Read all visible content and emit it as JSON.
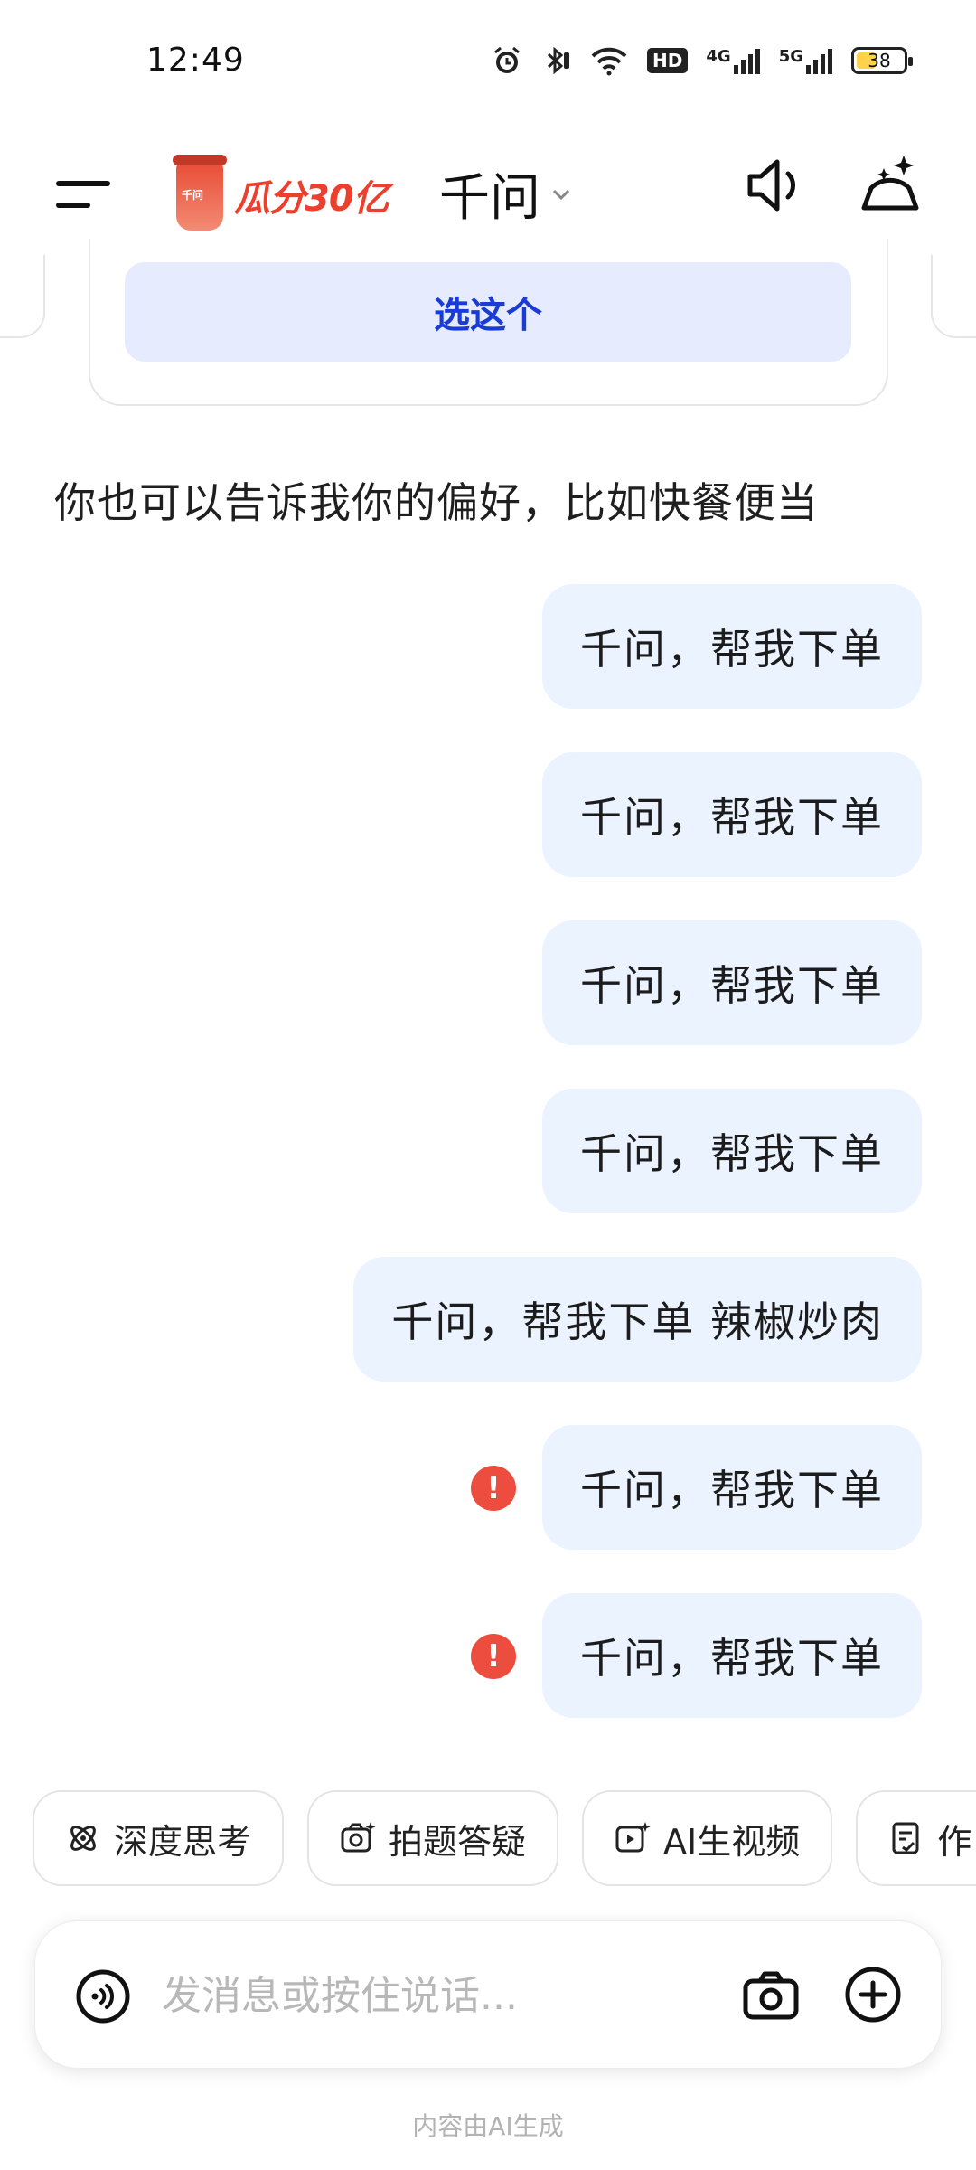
{
  "status_bar": {
    "time": "12:49",
    "battery": "38",
    "network_labels": [
      "HD",
      "4G",
      "5G"
    ]
  },
  "header": {
    "promo_text": "瓜分30亿",
    "promo_cup_text": "千问",
    "title": "千问"
  },
  "card": {
    "choose_label": "选这个"
  },
  "assistant_message": "你也可以告诉我你的偏好，比如快餐便当",
  "user_messages": [
    {
      "text": "千问，帮我下单",
      "error": false
    },
    {
      "text": "千问，帮我下单",
      "error": false
    },
    {
      "text": "千问，帮我下单",
      "error": false
    },
    {
      "text": "千问，帮我下单",
      "error": false
    },
    {
      "text": "千问，帮我下单 辣椒炒肉",
      "error": false
    },
    {
      "text": "千问，帮我下单",
      "error": true
    },
    {
      "text": "千问，帮我下单",
      "error": true
    }
  ],
  "chips": [
    {
      "label": "深度思考",
      "icon": "atom-icon"
    },
    {
      "label": "拍题答疑",
      "icon": "camera-question-icon"
    },
    {
      "label": "AI生视频",
      "icon": "video-spark-icon"
    },
    {
      "label": "作",
      "icon": "document-icon"
    }
  ],
  "input": {
    "placeholder": "发消息或按住说话..."
  },
  "footer_note": "内容由AI生成",
  "colors": {
    "bubble_bg": "#eaf3ff",
    "accent_blue": "#1a3cd6",
    "error_red": "#ec4d3e",
    "promo_red": "#ec3f2d"
  }
}
